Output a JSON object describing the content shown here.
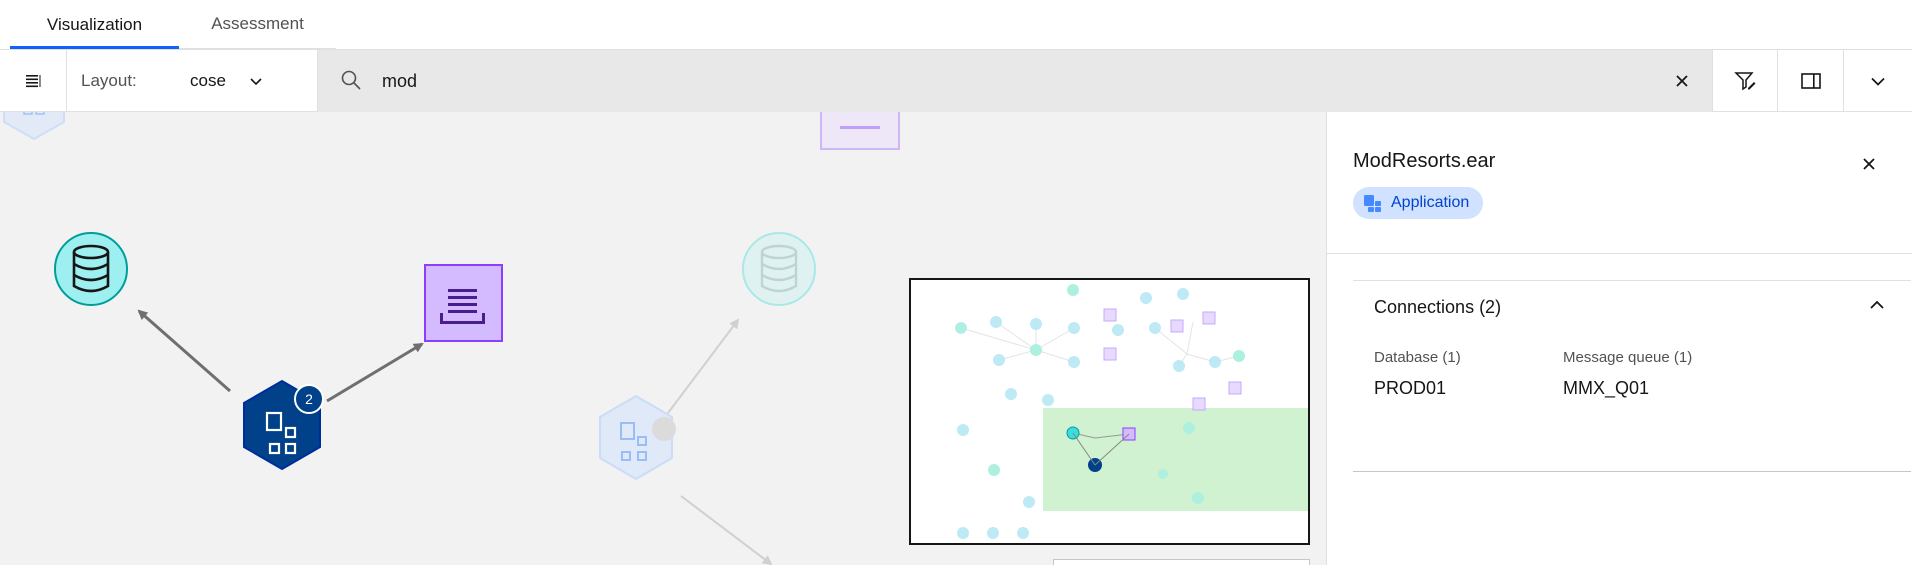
{
  "tabs": [
    {
      "label": "Visualization",
      "active": true
    },
    {
      "label": "Assessment",
      "active": false
    }
  ],
  "toolbar": {
    "layout_label": "Layout:",
    "layout_value": "cose",
    "search_value": "mod",
    "icons": [
      "list-icon",
      "chevron-down-icon",
      "search-icon",
      "close-icon",
      "filter-edit-icon",
      "side-panel-icon",
      "chevron-down-icon"
    ]
  },
  "graph": {
    "badge_count": "2",
    "node_types": [
      "database",
      "message-queue",
      "application"
    ]
  },
  "side_panel": {
    "title": "ModResorts.ear",
    "tag_label": "Application",
    "accordion": {
      "label": "Connections (2)",
      "expanded": true,
      "columns": [
        {
          "label": "Database (1)",
          "value": "PROD01"
        },
        {
          "label": "Message queue (1)",
          "value": "MMX_Q01"
        }
      ]
    }
  },
  "colors": {
    "accent": "#0f62fe",
    "app_node": "#00418a",
    "database_node": "#3ddbd9",
    "queue_node": "#d4bbff",
    "tag_bg": "#d0e2ff",
    "tag_text": "#0043ce",
    "minimap_highlight": "#c8f0c8"
  }
}
